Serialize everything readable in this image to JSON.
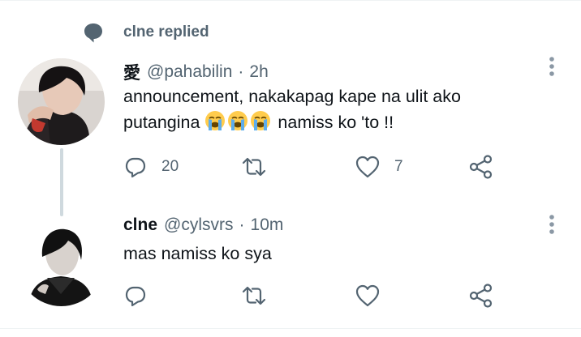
{
  "context": {
    "text": "clne replied",
    "icon": "reply-bubble-icon"
  },
  "tweets": [
    {
      "name": "愛",
      "handle": "@pahabilin",
      "separator": "·",
      "time": "2h",
      "text_line1": "announcement, nakakapag kape na ulit ako",
      "text_line2_before": "putangina ",
      "emojis": [
        "loudly-crying-face",
        "loudly-crying-face",
        "loudly-crying-face"
      ],
      "text_line2_after": " namiss ko 'to !!",
      "replies": "20",
      "retweets": "",
      "likes": "7"
    },
    {
      "name": "clne",
      "handle": "@cylsvrs",
      "separator": "·",
      "time": "10m",
      "text": "mas namiss ko sya",
      "replies": "",
      "retweets": "",
      "likes": ""
    }
  ],
  "colors": {
    "secondary": "#536471",
    "primary_text": "#0f1419",
    "thread_line": "#cfd9de"
  }
}
